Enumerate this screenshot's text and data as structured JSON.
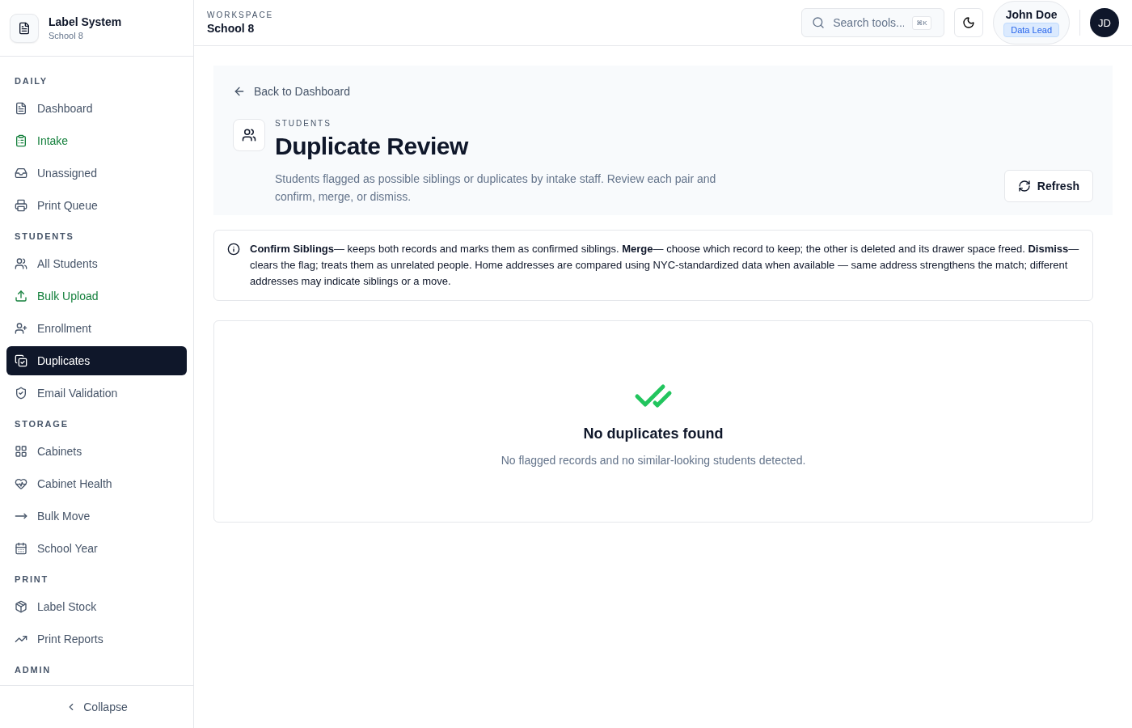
{
  "brand": {
    "title": "Label System",
    "subtitle": "School 8"
  },
  "sidebar": {
    "sections": [
      {
        "heading": "DAILY",
        "items": [
          {
            "label": "Dashboard",
            "selected": false,
            "accent": false
          },
          {
            "label": "Intake",
            "selected": false,
            "accent": true
          },
          {
            "label": "Unassigned",
            "selected": false,
            "accent": false
          },
          {
            "label": "Print Queue",
            "selected": false,
            "accent": false
          }
        ]
      },
      {
        "heading": "STUDENTS",
        "items": [
          {
            "label": "All Students",
            "selected": false,
            "accent": false
          },
          {
            "label": "Bulk Upload",
            "selected": false,
            "accent": true
          },
          {
            "label": "Enrollment",
            "selected": false,
            "accent": false
          },
          {
            "label": "Duplicates",
            "selected": true,
            "accent": false
          },
          {
            "label": "Email Validation",
            "selected": false,
            "accent": false
          }
        ]
      },
      {
        "heading": "STORAGE",
        "items": [
          {
            "label": "Cabinets",
            "selected": false,
            "accent": false
          },
          {
            "label": "Cabinet Health",
            "selected": false,
            "accent": false
          },
          {
            "label": "Bulk Move",
            "selected": false,
            "accent": false
          },
          {
            "label": "School Year",
            "selected": false,
            "accent": false
          }
        ]
      },
      {
        "heading": "PRINT",
        "items": [
          {
            "label": "Label Stock",
            "selected": false,
            "accent": false
          },
          {
            "label": "Print Reports",
            "selected": false,
            "accent": false
          }
        ]
      },
      {
        "heading": "ADMIN"
      }
    ],
    "collapse": "Collapse"
  },
  "topbar": {
    "eyebrow": "WORKSPACE",
    "workspace": "School 8",
    "search": {
      "placeholder": "Search tools...",
      "shortcut": "⌘K"
    },
    "user": {
      "name": "John Doe",
      "role": "Data Lead",
      "initials": "JD"
    }
  },
  "page": {
    "back": "Back to Dashboard",
    "eyebrow": "STUDENTS",
    "title": "Duplicate Review",
    "description": "Students flagged as possible siblings or duplicates by intake staff. Review each pair and confirm, merge, or dismiss.",
    "refresh": "Refresh",
    "info": "**Confirm Siblings**— keeps both records and marks them as confirmed siblings.  **Merge**— choose which record to keep; the other is deleted and its drawer space freed.  **Dismiss**— clears the flag; treats them as unrelated people.   Home addresses are compared using NYC-standardized data when available — same address strengthens the match; different addresses may indicate siblings or a move.",
    "empty": {
      "title": "No duplicates found",
      "text": "No flagged records and no similar-looking students detected."
    }
  }
}
